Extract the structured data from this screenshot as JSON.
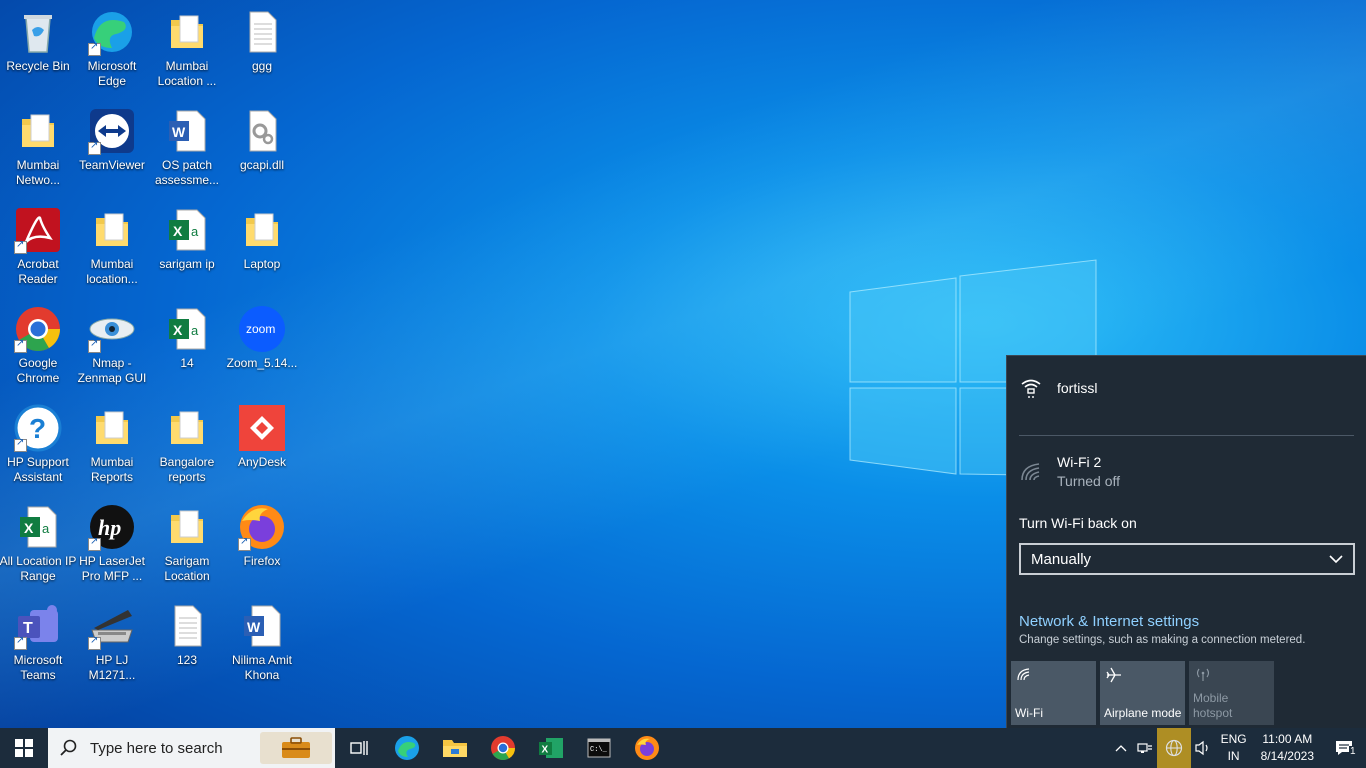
{
  "desktop": {
    "icons": [
      {
        "label": "Recycle Bin",
        "icon": "recycle-bin-icon"
      },
      {
        "label": "Microsoft Edge",
        "icon": "edge-icon"
      },
      {
        "label": "Mumbai Location ...",
        "icon": "folder-icon"
      },
      {
        "label": "ggg",
        "icon": "text-file-icon"
      },
      {
        "label": "Mumbai Netwo...",
        "icon": "folder-icon"
      },
      {
        "label": "TeamViewer",
        "icon": "teamviewer-icon"
      },
      {
        "label": "OS patch assessme...",
        "icon": "word-doc-icon"
      },
      {
        "label": "gcapi.dll",
        "icon": "dll-file-icon"
      },
      {
        "label": "Acrobat Reader",
        "icon": "acrobat-icon"
      },
      {
        "label": "Mumbai location...",
        "icon": "folder-icon"
      },
      {
        "label": "sarigam ip",
        "icon": "excel-file-icon"
      },
      {
        "label": "Laptop",
        "icon": "folder-icon"
      },
      {
        "label": "Google Chrome",
        "icon": "chrome-icon"
      },
      {
        "label": "Nmap - Zenmap GUI",
        "icon": "nmap-icon"
      },
      {
        "label": "14",
        "icon": "excel-file-icon"
      },
      {
        "label": "Zoom_5.14...",
        "icon": "zoom-icon"
      },
      {
        "label": "HP Support Assistant",
        "icon": "hp-support-icon"
      },
      {
        "label": "Mumbai Reports",
        "icon": "folder-icon"
      },
      {
        "label": "Bangalore reports",
        "icon": "folder-icon"
      },
      {
        "label": "AnyDesk",
        "icon": "anydesk-icon"
      },
      {
        "label": "All Location IP Range",
        "icon": "excel-file-icon"
      },
      {
        "label": "HP LaserJet Pro MFP ...",
        "icon": "hp-icon"
      },
      {
        "label": "Sarigam Location",
        "icon": "folder-icon"
      },
      {
        "label": "Firefox",
        "icon": "firefox-icon"
      },
      {
        "label": "Microsoft Teams",
        "icon": "teams-icon"
      },
      {
        "label": "HP LJ M1271...",
        "icon": "scanner-icon"
      },
      {
        "label": "123",
        "icon": "text-file-icon"
      },
      {
        "label": "Nilima Amit Khona",
        "icon": "word-doc-icon"
      }
    ]
  },
  "flyout": {
    "connected_network": "fortissl",
    "wifi_name": "Wi-Fi 2",
    "wifi_status": "Turned off",
    "turn_on_label": "Turn Wi-Fi back on",
    "dropdown_value": "Manually",
    "settings_link": "Network & Internet settings",
    "settings_desc": "Change settings, such as making a connection metered.",
    "tiles": [
      {
        "label": "Wi-Fi",
        "icon": "wifi-icon",
        "state": "off"
      },
      {
        "label": "Airplane mode",
        "icon": "airplane-icon",
        "state": "off"
      },
      {
        "label": "Mobile hotspot",
        "icon": "hotspot-icon",
        "state": "disabled"
      }
    ]
  },
  "taskbar": {
    "search_placeholder": "Type here to search",
    "lang_top": "ENG",
    "lang_bottom": "IN",
    "time": "11:00 AM",
    "date": "8/14/2023",
    "notification_count": "1"
  },
  "colors": {
    "taskbar_bg": "#1c2c3c",
    "flyout_bg": "#1f2a35",
    "link": "#8fd0ff"
  }
}
